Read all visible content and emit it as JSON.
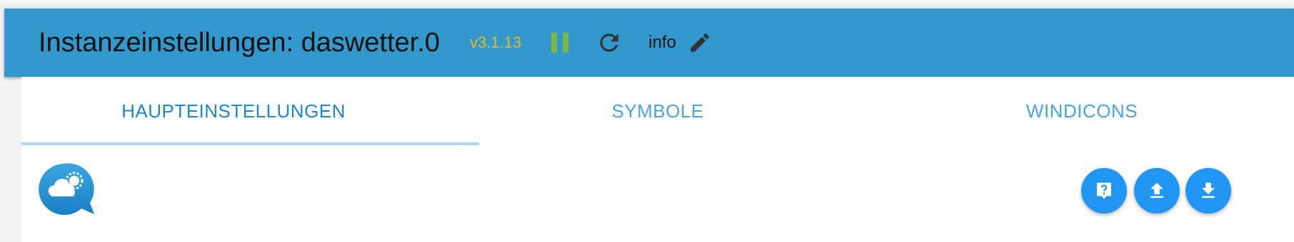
{
  "header": {
    "title": "Instanzeinstellungen: daswetter.0",
    "version": "v3.1.13",
    "info_label": "info",
    "pause_icon": "pause-icon",
    "reload_icon": "reload-icon",
    "edit_icon": "pencil-icon"
  },
  "tabs": [
    {
      "label": "HAUPTEINSTELLUNGEN",
      "active": true
    },
    {
      "label": "SYMBOLE",
      "active": false
    },
    {
      "label": "WINDICONS",
      "active": false
    }
  ],
  "logo": {
    "icon": "daswetter-logo-icon"
  },
  "actions": [
    {
      "icon": "help-icon"
    },
    {
      "icon": "upload-icon"
    },
    {
      "icon": "download-icon"
    }
  ],
  "colors": {
    "header_bg": "#3399cc",
    "version": "#f0b429",
    "pause": "#7ab648",
    "tab_active": "#1a87d5",
    "tab_inactive": "#4aa3df",
    "tab_indicator": "#a9d4f2",
    "fab": "#2196f3"
  }
}
